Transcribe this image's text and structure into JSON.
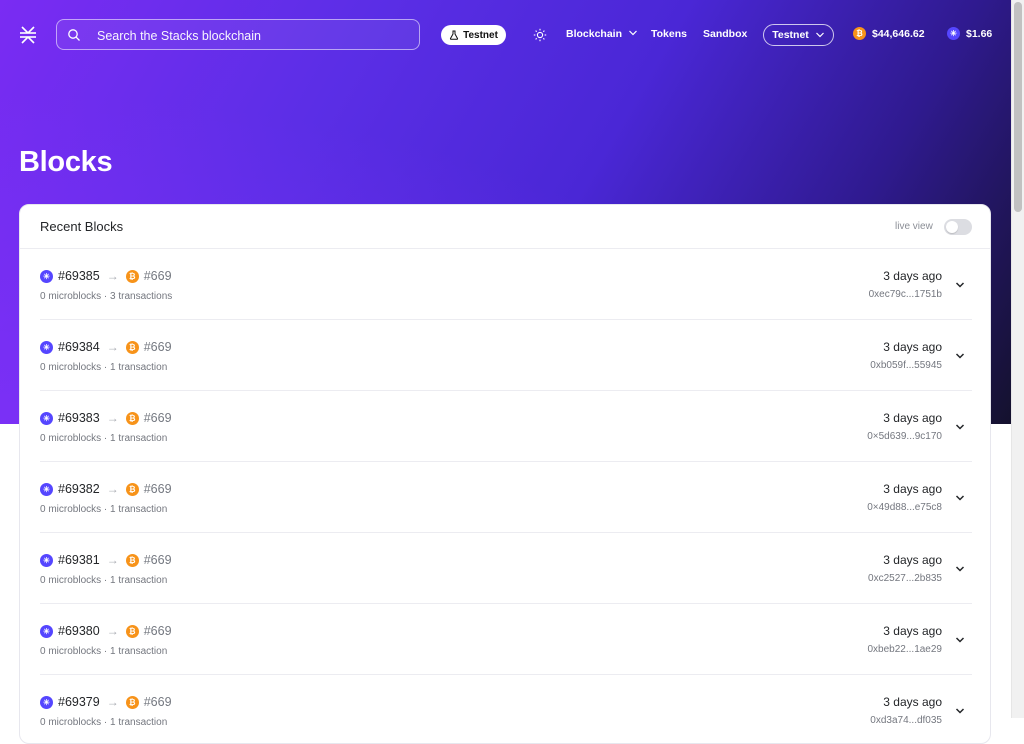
{
  "header": {
    "search_placeholder": "Search the Stacks blockchain",
    "network_badge": "Testnet",
    "nav_links": [
      "Blockchain",
      "Tokens",
      "Sandbox"
    ],
    "network_selector": "Testnet",
    "btc_price": "$44,646.62",
    "stx_price": "$1.66"
  },
  "page": {
    "title": "Blocks"
  },
  "recent_blocks": {
    "title": "Recent Blocks",
    "live_view_label": "live view",
    "live_view_on": false,
    "rows": [
      {
        "block": "#69385",
        "btc_block": "#669",
        "summary": "0 microblocks · 3 transactions",
        "time": "3 days ago",
        "hash": "0xec79c...1751b"
      },
      {
        "block": "#69384",
        "btc_block": "#669",
        "summary": "0 microblocks · 1 transaction",
        "time": "3 days ago",
        "hash": "0xb059f...55945"
      },
      {
        "block": "#69383",
        "btc_block": "#669",
        "summary": "0 microblocks · 1 transaction",
        "time": "3 days ago",
        "hash": "0×5d639...9c170"
      },
      {
        "block": "#69382",
        "btc_block": "#669",
        "summary": "0 microblocks · 1 transaction",
        "time": "3 days ago",
        "hash": "0×49d88...e75c8"
      },
      {
        "block": "#69381",
        "btc_block": "#669",
        "summary": "0 microblocks · 1 transaction",
        "time": "3 days ago",
        "hash": "0xc2527...2b835"
      },
      {
        "block": "#69380",
        "btc_block": "#669",
        "summary": "0 microblocks · 1 transaction",
        "time": "3 days ago",
        "hash": "0xbeb22...1ae29"
      },
      {
        "block": "#69379",
        "btc_block": "#669",
        "summary": "0 microblocks · 1 transaction",
        "time": "3 days ago",
        "hash": "0xd3a74...df035"
      }
    ]
  },
  "icons": {
    "logo": "stacks-logo-icon",
    "search": "search-icon",
    "flask": "flask-icon",
    "theme": "sun-icon",
    "chevron": "chevron-down-icon",
    "btc": "bitcoin-icon",
    "stx": "stacks-icon"
  },
  "colors": {
    "btc": "#f7931a",
    "stx": "#5546ff",
    "hero_start": "#7a2cf3",
    "hero_end": "#14112d"
  }
}
